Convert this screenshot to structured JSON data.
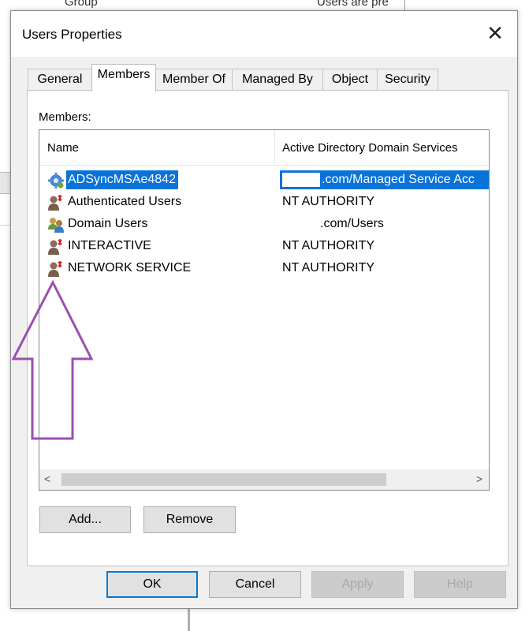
{
  "background": {
    "col_group": "Group",
    "col_desc": "Users are pre"
  },
  "dialog": {
    "title": "Users Properties",
    "close_glyph": "✕"
  },
  "tabs": [
    {
      "label": "General",
      "active": false
    },
    {
      "label": "Members",
      "active": true
    },
    {
      "label": "Member Of",
      "active": false
    },
    {
      "label": "Managed By",
      "active": false
    },
    {
      "label": "Object",
      "active": false
    },
    {
      "label": "Security",
      "active": false
    }
  ],
  "members": {
    "label": "Members:",
    "columns": [
      "Name",
      "Active Directory Domain Services"
    ],
    "rows": [
      {
        "name": "ADSyncMSAe4842",
        "folder": ".com/Managed Service Acc",
        "icon": "service-account-icon",
        "selected": true
      },
      {
        "name": "Authenticated Users",
        "folder": "NT AUTHORITY",
        "icon": "well-known-user-icon",
        "selected": false
      },
      {
        "name": "Domain Users",
        "folder": ".com/Users",
        "icon": "group-icon",
        "selected": false
      },
      {
        "name": "INTERACTIVE",
        "folder": "NT AUTHORITY",
        "icon": "well-known-user-icon",
        "selected": false
      },
      {
        "name": "NETWORK SERVICE",
        "folder": "NT AUTHORITY",
        "icon": "well-known-user-icon",
        "selected": false
      }
    ]
  },
  "scrollbar": {
    "left_arrow": "<",
    "right_arrow": ">"
  },
  "buttons": {
    "add": "Add...",
    "remove": "Remove",
    "ok": "OK",
    "cancel": "Cancel",
    "apply": "Apply",
    "help": "Help"
  },
  "colors": {
    "selection": "#0a73d8",
    "annotation_arrow": "#9b4fb0"
  }
}
